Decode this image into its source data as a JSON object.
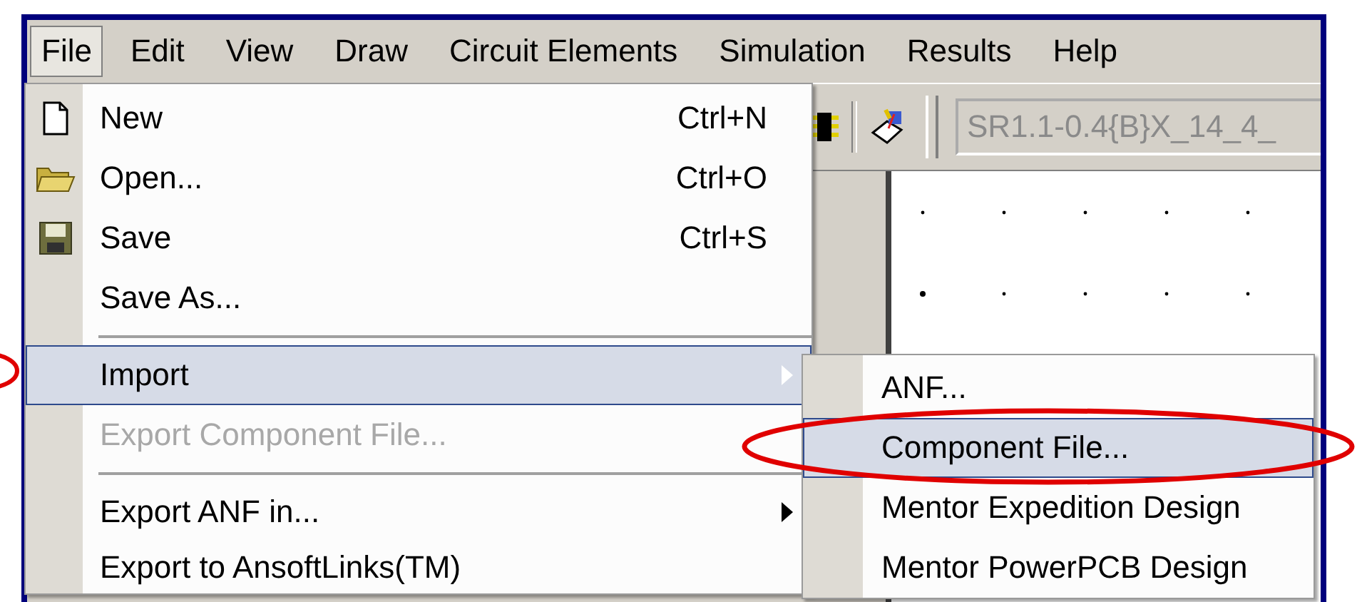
{
  "menubar": [
    {
      "label": "File",
      "selected": true
    },
    {
      "label": "Edit",
      "selected": false
    },
    {
      "label": "View",
      "selected": false
    },
    {
      "label": "Draw",
      "selected": false
    },
    {
      "label": "Circuit Elements",
      "selected": false
    },
    {
      "label": "Simulation",
      "selected": false
    },
    {
      "label": "Results",
      "selected": false
    },
    {
      "label": "Help",
      "selected": false
    }
  ],
  "toolbar": {
    "component_combo": {
      "value": "SR1.1-0.4{B}X_14_4_"
    }
  },
  "file_menu": {
    "items": [
      {
        "kind": "item",
        "label": "New",
        "shortcut": "Ctrl+N",
        "disabled": false,
        "selected": false,
        "submenu": false
      },
      {
        "kind": "item",
        "label": "Open...",
        "shortcut": "Ctrl+O",
        "disabled": false,
        "selected": false,
        "submenu": false
      },
      {
        "kind": "item",
        "label": "Save",
        "shortcut": "Ctrl+S",
        "disabled": false,
        "selected": false,
        "submenu": false
      },
      {
        "kind": "item",
        "label": "Save As...",
        "disabled": false,
        "selected": false,
        "submenu": false
      },
      {
        "kind": "separator"
      },
      {
        "kind": "item",
        "label": "Import",
        "disabled": false,
        "selected": true,
        "submenu": true
      },
      {
        "kind": "item",
        "label": "Export Component File...",
        "disabled": true,
        "selected": false,
        "submenu": false
      },
      {
        "kind": "separator"
      },
      {
        "kind": "item",
        "label": "Export ANF in...",
        "disabled": false,
        "selected": false,
        "submenu": true
      },
      {
        "kind": "item",
        "label": "Export to AnsoftLinks(TM)",
        "disabled": false,
        "selected": false,
        "submenu": false
      }
    ]
  },
  "import_submenu": {
    "items": [
      {
        "label": "ANF...",
        "selected": false
      },
      {
        "label": "Component File...",
        "selected": true
      },
      {
        "label": "Mentor Expedition Design",
        "selected": false
      },
      {
        "label": "Mentor PowerPCB Design",
        "selected": false
      }
    ]
  }
}
